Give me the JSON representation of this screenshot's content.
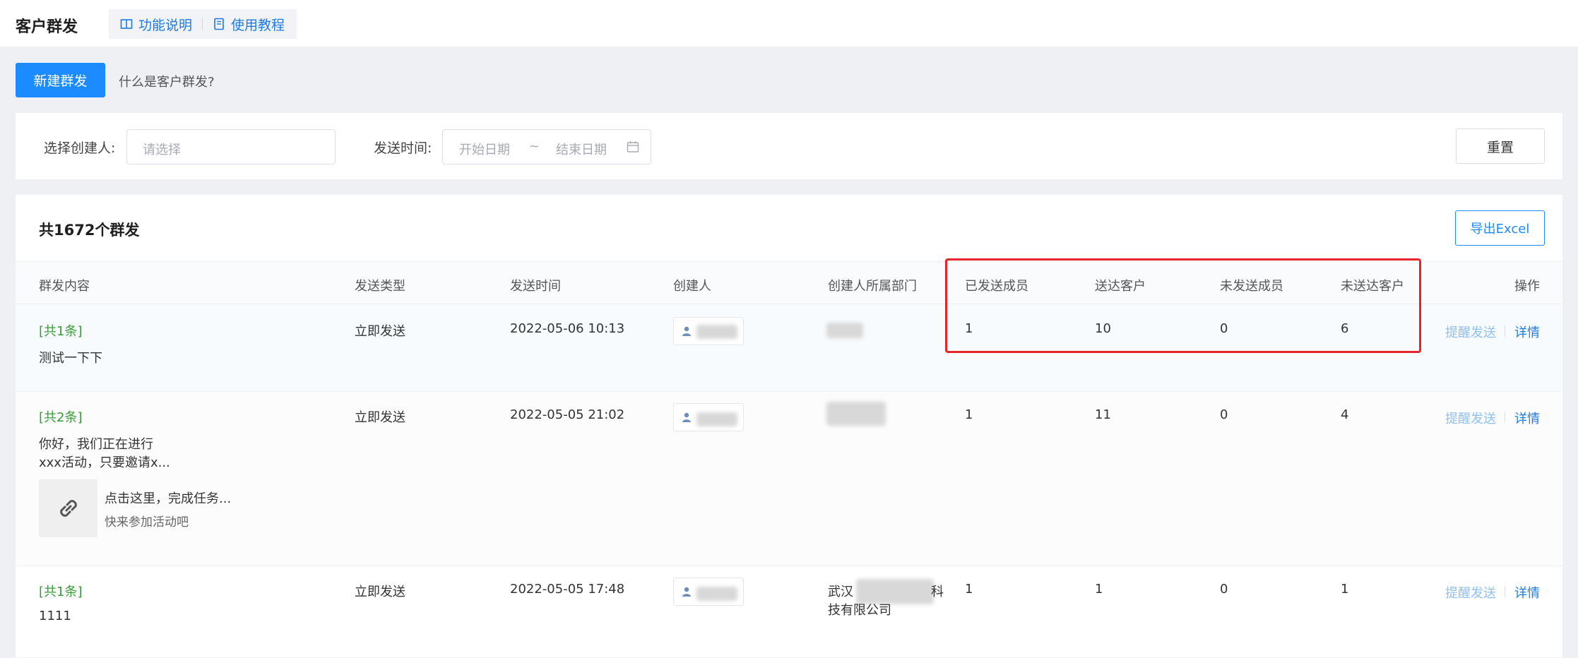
{
  "header": {
    "title": "客户群发",
    "help_function": "功能说明",
    "help_tutorial": "使用教程"
  },
  "actions": {
    "new_label": "新建群发",
    "what_link": "什么是客户群发?"
  },
  "filter": {
    "creator_label": "选择创建人:",
    "creator_placeholder": "请选择",
    "time_label": "发送时间:",
    "start_placeholder": "开始日期",
    "tilde": "~",
    "end_placeholder": "结束日期",
    "reset_label": "重置"
  },
  "list": {
    "count_text": "共1672个群发",
    "export_label": "导出Excel",
    "columns": [
      "群发内容",
      "发送类型",
      "发送时间",
      "创建人",
      "创建人所属部门",
      "已发送成员",
      "送达客户",
      "未发送成员",
      "未送达客户",
      "操作"
    ],
    "rows": [
      {
        "count_tag": "[共1条]",
        "text1": "测试一下下",
        "text2": "",
        "type": "立即发送",
        "time": "2022-05-06 10:13",
        "dept": "",
        "sent_members": "1",
        "delivered": "10",
        "unsent_members": "0",
        "undelivered": "6",
        "remind": "提醒发送",
        "detail": "详情"
      },
      {
        "count_tag": "[共2条]",
        "text1": "你好，我们正在进行",
        "text2": "xxx活动，只要邀请x...",
        "link_title": "点击这里，完成任务...",
        "link_sub": "快来参加活动吧",
        "type": "立即发送",
        "time": "2022-05-05 21:02",
        "dept": "",
        "sent_members": "1",
        "delivered": "11",
        "unsent_members": "0",
        "undelivered": "4",
        "remind": "提醒发送",
        "detail": "详情"
      },
      {
        "count_tag": "[共1条]",
        "text1": "1111",
        "text2": "",
        "type": "立即发送",
        "time": "2022-05-05 17:48",
        "dept1": "武汉",
        "dept1b": "科",
        "dept2": "技有限公司",
        "sent_members": "1",
        "delivered": "1",
        "unsent_members": "0",
        "undelivered": "1",
        "remind": "提醒发送",
        "detail": "详情"
      }
    ]
  },
  "colors": {
    "primary": "#1b8bff",
    "highlight_border": "#e5242b",
    "count_tag": "#3a9b3a",
    "remind_link": "#8ec0f5"
  }
}
